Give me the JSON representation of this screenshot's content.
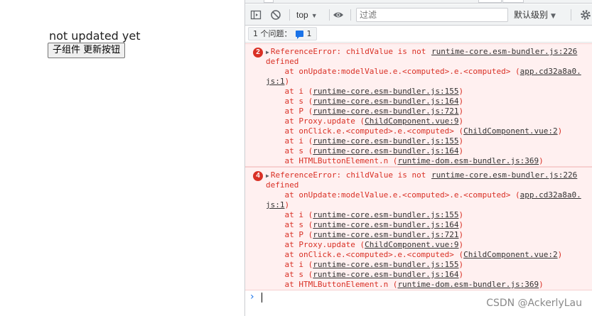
{
  "page": {
    "status_text": "not updated yet",
    "button_label": "子组件 更新按钮"
  },
  "devtools": {
    "toolbar": {
      "context": "top",
      "filter_placeholder": "过滤",
      "levels_label": "默认级别",
      "icons": [
        "sidebar-toggle-icon",
        "clear-console-icon",
        "eye-icon",
        "gear-icon"
      ]
    },
    "issues": {
      "label": "1 个问题：",
      "count": "1"
    },
    "messages": [
      {
        "count": "2",
        "error": "ReferenceError: childValue is not",
        "error_cont": "defined",
        "source": "runtime-core.esm-bundler.js:226",
        "frames": [
          {
            "prefix": "    at onUpdate:modelValue.e.<computed>.e.<computed> (",
            "link": "app.cd32a8a0.",
            "suffix": ""
          },
          {
            "prefix": "",
            "link": "js:1",
            "suffix": ")"
          },
          {
            "prefix": "    at i (",
            "link": "runtime-core.esm-bundler.js:155",
            "suffix": ")"
          },
          {
            "prefix": "    at s (",
            "link": "runtime-core.esm-bundler.js:164",
            "suffix": ")"
          },
          {
            "prefix": "    at P (",
            "link": "runtime-core.esm-bundler.js:721",
            "suffix": ")"
          },
          {
            "prefix": "    at Proxy.update (",
            "link": "ChildComponent.vue:9",
            "suffix": ")"
          },
          {
            "prefix": "    at onClick.e.<computed>.e.<computed> (",
            "link": "ChildComponent.vue:2",
            "suffix": ")"
          },
          {
            "prefix": "    at i (",
            "link": "runtime-core.esm-bundler.js:155",
            "suffix": ")"
          },
          {
            "prefix": "    at s (",
            "link": "runtime-core.esm-bundler.js:164",
            "suffix": ")"
          },
          {
            "prefix": "    at HTMLButtonElement.n (",
            "link": "runtime-dom.esm-bundler.js:369",
            "suffix": ")"
          }
        ]
      },
      {
        "count": "4",
        "error": "ReferenceError: childValue is not",
        "error_cont": "defined",
        "source": "runtime-core.esm-bundler.js:226",
        "frames": [
          {
            "prefix": "    at onUpdate:modelValue.e.<computed>.e.<computed> (",
            "link": "app.cd32a8a0.",
            "suffix": ""
          },
          {
            "prefix": "",
            "link": "js:1",
            "suffix": ")"
          },
          {
            "prefix": "    at i (",
            "link": "runtime-core.esm-bundler.js:155",
            "suffix": ")"
          },
          {
            "prefix": "    at s (",
            "link": "runtime-core.esm-bundler.js:164",
            "suffix": ")"
          },
          {
            "prefix": "    at P (",
            "link": "runtime-core.esm-bundler.js:721",
            "suffix": ")"
          },
          {
            "prefix": "    at Proxy.update (",
            "link": "ChildComponent.vue:9",
            "suffix": ")"
          },
          {
            "prefix": "    at onClick.e.<computed>.e.<computed> (",
            "link": "ChildComponent.vue:2",
            "suffix": ")"
          },
          {
            "prefix": "    at i (",
            "link": "runtime-core.esm-bundler.js:155",
            "suffix": ")"
          },
          {
            "prefix": "    at s (",
            "link": "runtime-core.esm-bundler.js:164",
            "suffix": ")"
          },
          {
            "prefix": "    at HTMLButtonElement.n (",
            "link": "runtime-dom.esm-bundler.js:369",
            "suffix": ")"
          }
        ]
      }
    ],
    "prompt_symbol": "›"
  },
  "watermark": "CSDN @AckerlyLau",
  "colors": {
    "error_text": "#d93025",
    "error_bg": "#fff0f0",
    "accent": "#1a73e8"
  }
}
